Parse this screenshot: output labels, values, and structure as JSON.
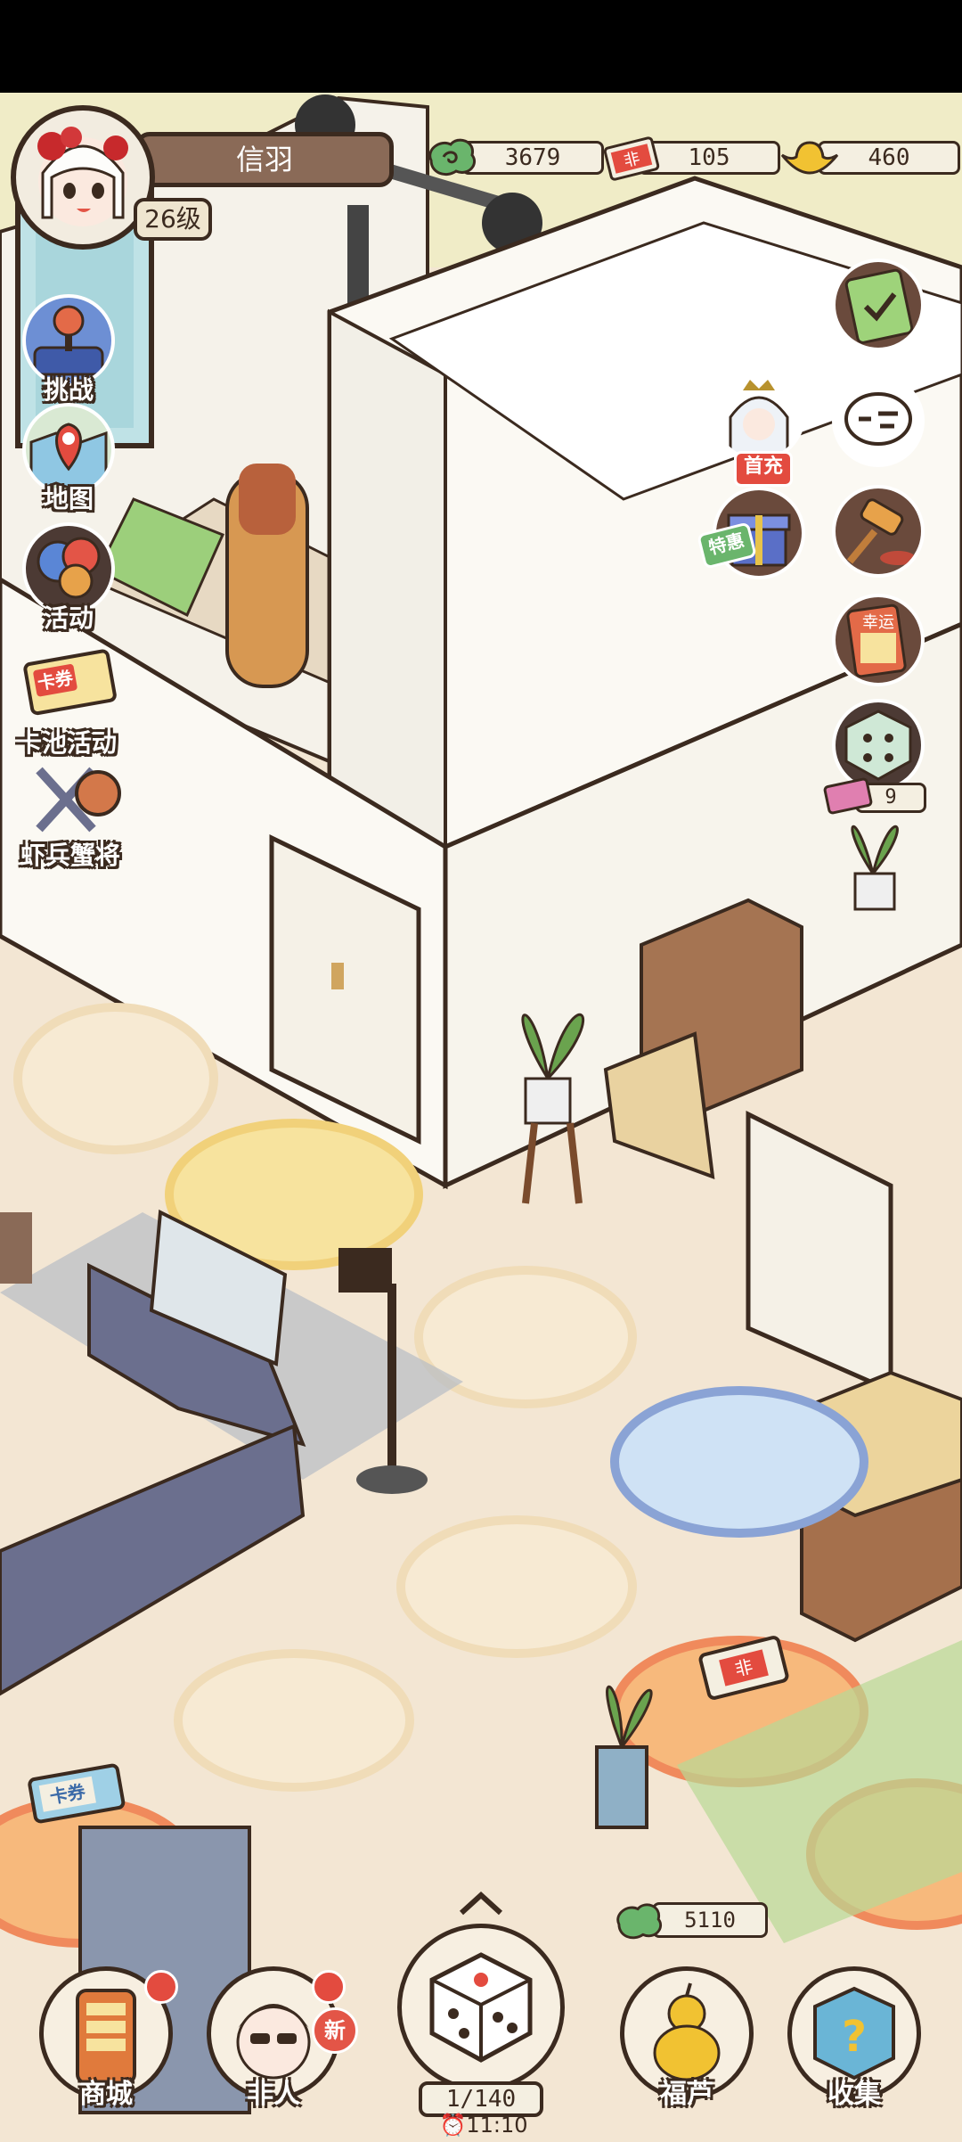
{
  "player": {
    "name": "信羽",
    "level": "26级"
  },
  "resources": {
    "coins": "3679",
    "cards": "105",
    "gold": "460"
  },
  "resource_icons": {
    "cards_label": "非"
  },
  "left_menu": [
    {
      "label": "挑战",
      "icon": "joystick-icon"
    },
    {
      "label": "地图",
      "icon": "map-pin-icon"
    },
    {
      "label": "活动",
      "icon": "balloons-icon"
    },
    {
      "label": "卡池活动",
      "icon": "card-ticket-icon",
      "badge": "卡券"
    },
    {
      "label": "虾兵蟹将",
      "icon": "crossed-weapons-icon"
    }
  ],
  "right_menu": {
    "first_recharge_label": "首充",
    "special_offer_label": "特惠",
    "lucky_card_label": "幸运",
    "dice_count": "9"
  },
  "board": {
    "bonus_coins": "5110",
    "card_tile_label": "非",
    "coupon_tile_label": "卡券"
  },
  "bottom_nav": [
    {
      "label": "商城",
      "icon": "shop-cabinet-icon"
    },
    {
      "label": "非人",
      "icon": "character-portrait-icon",
      "badge": "新"
    },
    {
      "label": "福芦",
      "icon": "gourd-icon"
    },
    {
      "label": "收集",
      "icon": "mystery-box-icon"
    }
  ],
  "dice": {
    "count": "1/140",
    "timer": "11:10"
  },
  "colors": {
    "outline": "#3b2a1f",
    "accent_red": "#e34b3f",
    "floor": "#f3e6d3",
    "wall": "#faf8f2"
  }
}
